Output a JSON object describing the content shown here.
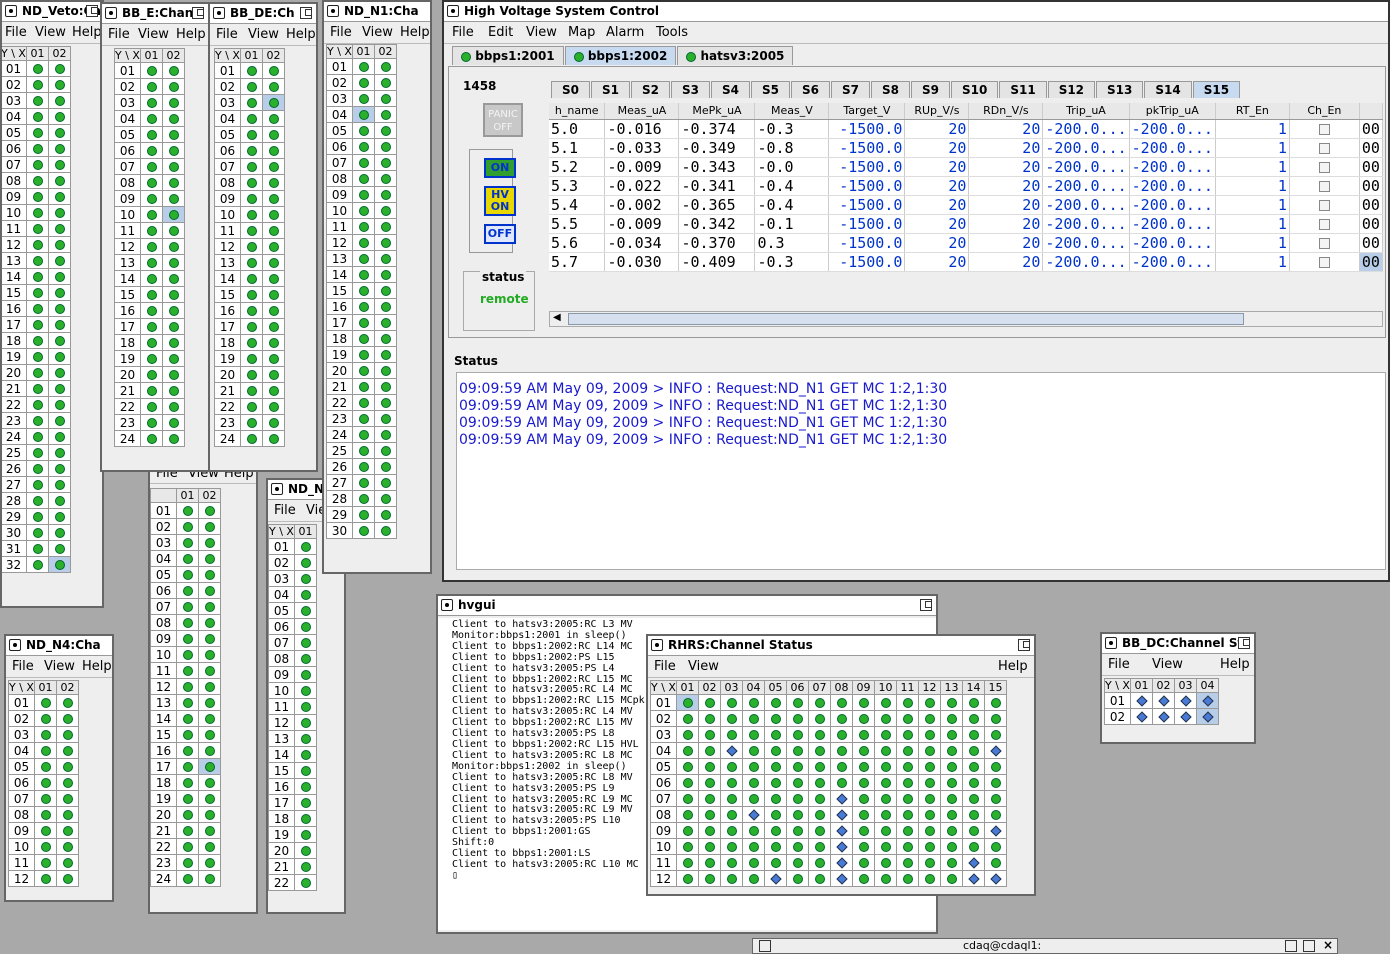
{
  "win_veto": {
    "title": "ND_Veto:Ch",
    "menu": [
      "File",
      "View",
      "Help"
    ],
    "hdr": [
      "Y \\ X",
      "01",
      "02"
    ],
    "rows": [
      "01",
      "02",
      "03",
      "04",
      "05",
      "06",
      "07",
      "08",
      "09",
      "10",
      "11",
      "12",
      "13",
      "14",
      "15",
      "16",
      "17",
      "18",
      "19",
      "20",
      "21",
      "22",
      "23",
      "24",
      "25",
      "26",
      "27",
      "28",
      "29",
      "30",
      "31",
      "32"
    ]
  },
  "win_bbe": {
    "title": "BB_E:Chan",
    "menu": [
      "File",
      "View",
      "Help"
    ],
    "hdr": [
      "Y \\ X",
      "01",
      "02"
    ],
    "rows": [
      "01",
      "02",
      "03",
      "04",
      "05",
      "06",
      "07",
      "08",
      "09",
      "10",
      "11",
      "12",
      "13",
      "14",
      "15",
      "16",
      "17",
      "18",
      "19",
      "20",
      "21",
      "22",
      "23",
      "24"
    ]
  },
  "win_bbde": {
    "title": "BB_DE:Ch",
    "menu": [
      "File",
      "View",
      "Help"
    ],
    "hdr": [
      "Y \\ X",
      "01",
      "02"
    ],
    "rows": [
      "01",
      "02",
      "03",
      "04",
      "05",
      "06",
      "07",
      "08",
      "09",
      "10",
      "11",
      "12",
      "13",
      "14",
      "15",
      "16",
      "17",
      "18",
      "19",
      "20",
      "21",
      "22",
      "23",
      "24"
    ]
  },
  "win_n1": {
    "title": "ND_N1:Cha",
    "menu": [
      "File",
      "View",
      "Help"
    ],
    "hdr": [
      "Y \\ X",
      "01",
      "02"
    ],
    "rows": [
      "01",
      "02",
      "03",
      "04",
      "05",
      "06",
      "07",
      "08",
      "09",
      "10",
      "11",
      "12",
      "13",
      "14",
      "15",
      "16",
      "17",
      "18",
      "19",
      "20",
      "21",
      "22",
      "23",
      "24",
      "25",
      "26",
      "27",
      "28",
      "29",
      "30"
    ]
  },
  "win_mid": {
    "menu": [
      "File",
      "View",
      "Help"
    ],
    "hdr": [
      "",
      "01",
      "02"
    ],
    "rows": [
      "01",
      "02",
      "03",
      "04",
      "05",
      "06",
      "07",
      "08",
      "09",
      "10",
      "11",
      "12",
      "13",
      "14",
      "15",
      "16",
      "17",
      "18",
      "19",
      "20",
      "21",
      "22",
      "23",
      "24"
    ]
  },
  "win_nd": {
    "title": "ND_N",
    "menu": [
      "File",
      "Vie"
    ],
    "hdr": [
      "Y \\ X",
      "01"
    ],
    "rows": [
      "01",
      "02",
      "03",
      "04",
      "05",
      "06",
      "07",
      "08",
      "09",
      "10",
      "11",
      "12",
      "13",
      "14",
      "15",
      "16",
      "17",
      "18",
      "19",
      "20",
      "21",
      "22"
    ]
  },
  "win_n4": {
    "title": "ND_N4:Cha",
    "menu": [
      "File",
      "View",
      "Help"
    ],
    "hdr": [
      "Y \\ X",
      "01",
      "02"
    ],
    "rows": [
      "01",
      "02",
      "03",
      "04",
      "05",
      "06",
      "07",
      "08",
      "09",
      "10",
      "11",
      "12"
    ]
  },
  "hv": {
    "title": "High Voltage System Control",
    "menu": [
      "File",
      "Edit",
      "View",
      "Map",
      "Alarm",
      "Tools"
    ],
    "hosts": [
      "bbps1:2001",
      "bbps1:2002",
      "hatsv3:2005"
    ],
    "id": "1458",
    "panic": "PANIC OFF",
    "on": "ON",
    "hvon": "HV ON",
    "off": "OFF",
    "status_label": "status",
    "status_value": "remote",
    "slots": [
      "S0",
      "S1",
      "S2",
      "S3",
      "S4",
      "S5",
      "S6",
      "S7",
      "S8",
      "S9",
      "S10",
      "S11",
      "S12",
      "S13",
      "S14",
      "S15"
    ],
    "columns": [
      "h_name",
      "Meas_uA",
      "MePk_uA",
      "Meas_V",
      "Target_V",
      "RUp_V/s",
      "RDn_V/s",
      "Trip_uA",
      "pkTrip_uA",
      "RT_En",
      "Ch_En",
      ""
    ],
    "rows": [
      [
        "5.0",
        "-0.016",
        "-0.374",
        "-0.3",
        "-1500.0",
        "20",
        "20",
        "-200.0...",
        "-200.0...",
        "1",
        "00"
      ],
      [
        "5.1",
        "-0.033",
        "-0.349",
        "-0.8",
        "-1500.0",
        "20",
        "20",
        "-200.0...",
        "-200.0...",
        "1",
        "00"
      ],
      [
        "5.2",
        "-0.009",
        "-0.343",
        "-0.0",
        "-1500.0",
        "20",
        "20",
        "-200.0...",
        "-200.0...",
        "1",
        "00"
      ],
      [
        "5.3",
        "-0.022",
        "-0.341",
        "-0.4",
        "-1500.0",
        "20",
        "20",
        "-200.0...",
        "-200.0...",
        "1",
        "00"
      ],
      [
        "5.4",
        "-0.002",
        "-0.365",
        "-0.4",
        "-1500.0",
        "20",
        "20",
        "-200.0...",
        "-200.0...",
        "1",
        "00"
      ],
      [
        "5.5",
        "-0.009",
        "-0.342",
        "-0.1",
        "-1500.0",
        "20",
        "20",
        "-200.0...",
        "-200.0...",
        "1",
        "00"
      ],
      [
        "5.6",
        "-0.034",
        "-0.370",
        "0.3",
        "-1500.0",
        "20",
        "20",
        "-200.0...",
        "-200.0...",
        "1",
        "00"
      ],
      [
        "5.7",
        "-0.030",
        "-0.409",
        "-0.3",
        "-1500.0",
        "20",
        "20",
        "-200.0...",
        "-200.0...",
        "1",
        "00"
      ]
    ],
    "status_title": "Status",
    "log": [
      "09:09:59 AM May 09, 2009 > INFO : Request:ND_N1 GET MC 1:2,1:30",
      "09:09:59 AM May 09, 2009 > INFO : Request:ND_N1 GET MC 1:2,1:30",
      "09:09:59 AM May 09, 2009 > INFO : Request:ND_N1 GET MC 1:2,1:30",
      "09:09:59 AM May 09, 2009 > INFO : Request:ND_N1 GET MC 1:2,1:30"
    ]
  },
  "hvgui": {
    "title": "hvgui",
    "lines": [
      "Client to hatsv3:2005:RC L3 MV",
      "Monitor:bbps1:2001 in sleep()",
      "Client to bbps1:2002:RC L14 MC",
      "Client to bbps1:2002:PS L15",
      "Client to hatsv3:2005:PS L4",
      "Client to bbps1:2002:RC L15 MC",
      "Client to hatsv3:2005:RC L4 MC",
      "Client to bbps1:2002:RC L15 MCpk",
      "Client to hatsv3:2005:RC L4 MV",
      "Client to bbps1:2002:RC L15 MV",
      "Client to hatsv3:2005:PS L8",
      "Client to bbps1:2002:RC L15 HVL",
      "Client to hatsv3:2005:RC L8 MC",
      "Monitor:bbps1:2002 in sleep()",
      "Client to hatsv3:2005:RC L8 MV",
      "Client to hatsv3:2005:PS L9",
      "Client to hatsv3:2005:RC L9 MC",
      "Client to hatsv3:2005:RC L9 MV",
      "Client to hatsv3:2005:PS L10",
      "Client to bbps1:2001:GS",
      "Shift:0",
      "Client to bbps1:2001:LS",
      "Client to hatsv3:2005:RC L10 MC"
    ]
  },
  "rhrs": {
    "title": "RHRS:Channel Status",
    "menu": [
      "File",
      "View",
      "Help"
    ],
    "hdr": [
      "Y \\ X",
      "01",
      "02",
      "03",
      "04",
      "05",
      "06",
      "07",
      "08",
      "09",
      "10",
      "11",
      "12",
      "13",
      "14",
      "15"
    ],
    "rows": [
      "01",
      "02",
      "03",
      "04",
      "05",
      "06",
      "07",
      "08",
      "09",
      "10",
      "11",
      "12"
    ]
  },
  "bbdc": {
    "title": "BB_DC:Channel St",
    "menu": [
      "File",
      "View",
      "Help"
    ],
    "hdr": [
      "Y \\ X",
      "01",
      "02",
      "03",
      "04"
    ],
    "rows": [
      "01",
      "02"
    ]
  },
  "terminal": {
    "title": "cdaq@cdaql1:"
  }
}
